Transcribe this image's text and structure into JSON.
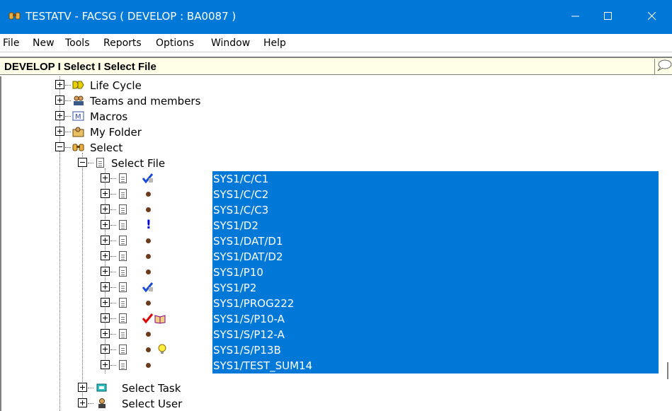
{
  "window": {
    "title": "TESTATV - FACSG ( DEVELOP : BA0087 )",
    "icons": [
      "binoculars-icon",
      "minimize-icon",
      "maximize-icon",
      "close-icon"
    ]
  },
  "menu": [
    "File",
    "New",
    "Tools",
    "Reports",
    "Options",
    "Window",
    "Help"
  ],
  "context_path": "DEVELOP I Select I Select File",
  "tree": {
    "top_nodes": [
      "Life Cycle",
      "Teams and members",
      "Macros",
      "My Folder",
      "Select"
    ],
    "select_children": [
      "Select File",
      "Select Task",
      "Select User"
    ],
    "files": [
      {
        "name": "SYS1/C/C1",
        "status": "checked-blue"
      },
      {
        "name": "SYS1/C/C2",
        "status": "dot"
      },
      {
        "name": "SYS1/C/C3",
        "status": "dot"
      },
      {
        "name": "SYS1/D2",
        "status": "exclamation"
      },
      {
        "name": "SYS1/DAT/D1",
        "status": "dot"
      },
      {
        "name": "SYS1/DAT/D2",
        "status": "dot"
      },
      {
        "name": "SYS1/P10",
        "status": "dot"
      },
      {
        "name": "SYS1/P2",
        "status": "checked-blue"
      },
      {
        "name": "SYS1/PROG222",
        "status": "dot"
      },
      {
        "name": "SYS1/S/P10-A",
        "status": "checked-red-book"
      },
      {
        "name": "SYS1/S/P12-A",
        "status": "dot"
      },
      {
        "name": "SYS1/S/P13B",
        "status": "dot-bulb"
      },
      {
        "name": "SYS1/TEST_SUM14",
        "status": "dot"
      }
    ]
  },
  "colors": {
    "titlebar": "#0078d7",
    "selection": "#0078d7",
    "context_bg": "#ffffe8"
  }
}
